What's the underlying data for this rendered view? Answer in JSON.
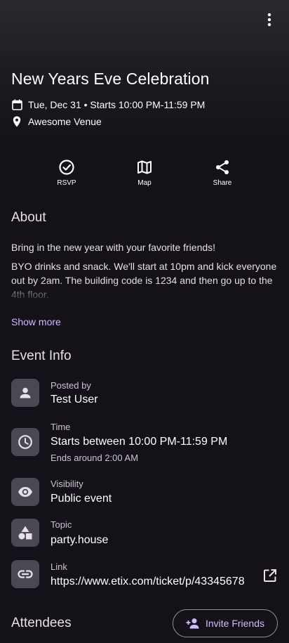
{
  "event": {
    "title": "New Years Eve Celebration",
    "date_line": "Tue, Dec 31 • Starts 10:00 PM-11:59 PM",
    "venue": "Awesome Venue"
  },
  "actions": {
    "rsvp_label": "RSVP",
    "map_label": "Map",
    "share_label": "Share"
  },
  "about": {
    "title": "About",
    "paragraph1": "Bring in the new year with your favorite friends!",
    "paragraph2": "BYO drinks and snack. We'll start at 10pm and kick everyone out by 2am. The building code is 1234 and then go up to the 4th floor.",
    "show_more": "Show more"
  },
  "event_info": {
    "title": "Event Info",
    "posted_by": {
      "label": "Posted by",
      "value": "Test User",
      "icon": "person-icon"
    },
    "time": {
      "label": "Time",
      "value": "Starts between 10:00 PM-11:59 PM",
      "sub": "Ends around 2:00 AM",
      "icon": "clock-icon"
    },
    "visibility": {
      "label": "Visibility",
      "value": "Public event",
      "icon": "eye-icon"
    },
    "topic": {
      "label": "Topic",
      "value": "party.house",
      "icon": "shapes-icon"
    },
    "link": {
      "label": "Link",
      "value": "https://www.etix.com/ticket/p/43345678",
      "icon": "link-icon"
    }
  },
  "attendees": {
    "title": "Attendees",
    "invite_label": "Invite Friends"
  },
  "colors": {
    "accent": "#cfbcff",
    "background": "#141218",
    "tile": "#4a4852"
  }
}
